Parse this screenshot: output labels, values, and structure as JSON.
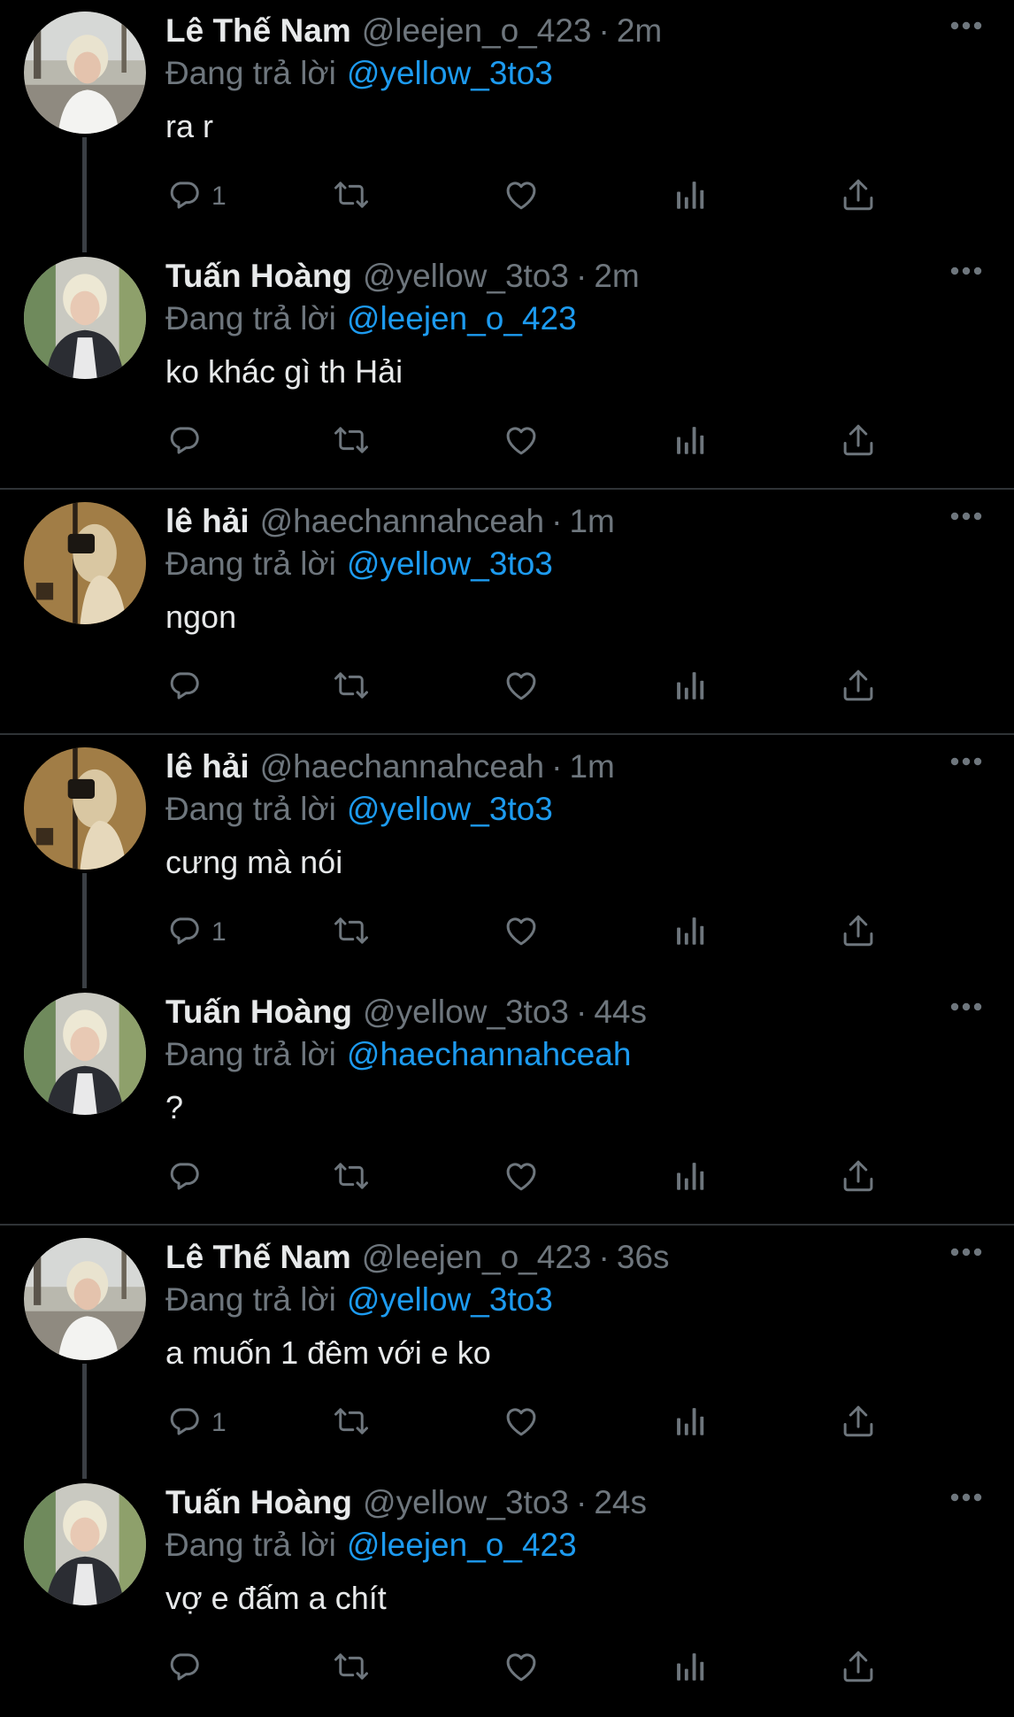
{
  "labels": {
    "replying_to": "Đang trả lời",
    "separator": "·"
  },
  "colors": {
    "background": "#000000",
    "text": "#e7e9ea",
    "muted": "#6e767d",
    "accent": "#1d9bf0",
    "divider": "#2f3336"
  },
  "icons": {
    "reply": "reply-icon",
    "retweet": "retweet-icon",
    "like": "heart-icon",
    "stats": "analytics-icon",
    "share": "share-icon",
    "more": "more-icon"
  },
  "tweets": [
    {
      "name": "Lê Thế Nam",
      "handle": "@leejen_o_423",
      "time": "2m",
      "reply_to": "@yellow_3to3",
      "text": "ra r",
      "reply_count": "1",
      "avatar": "blond-white-shirt",
      "thread_line": true
    },
    {
      "name": "Tuấn Hoàng",
      "handle": "@yellow_3to3",
      "time": "2m",
      "reply_to": "@leejen_o_423",
      "text": "ko khác gì th Hải",
      "reply_count": "",
      "avatar": "blond-tweed-jacket",
      "thread_line": false
    },
    {
      "name": "lê hải",
      "handle": "@haechannahceah",
      "time": "1m",
      "reply_to": "@yellow_3to3",
      "text": "ngon",
      "reply_count": "",
      "avatar": "camera-mirror",
      "thread_line": false
    },
    {
      "name": "lê hải",
      "handle": "@haechannahceah",
      "time": "1m",
      "reply_to": "@yellow_3to3",
      "text": "cưng mà nói",
      "reply_count": "1",
      "avatar": "camera-mirror",
      "thread_line": true
    },
    {
      "name": "Tuấn Hoàng",
      "handle": "@yellow_3to3",
      "time": "44s",
      "reply_to": "@haechannahceah",
      "text": "?",
      "reply_count": "",
      "avatar": "blond-tweed-jacket",
      "thread_line": false
    },
    {
      "name": "Lê Thế Nam",
      "handle": "@leejen_o_423",
      "time": "36s",
      "reply_to": "@yellow_3to3",
      "text": "a muốn 1 đêm với e ko",
      "reply_count": "1",
      "avatar": "blond-white-shirt",
      "thread_line": true
    },
    {
      "name": "Tuấn Hoàng",
      "handle": "@yellow_3to3",
      "time": "24s",
      "reply_to": "@leejen_o_423",
      "text": "vợ e đấm a chít",
      "reply_count": "",
      "avatar": "blond-tweed-jacket",
      "thread_line": false
    }
  ]
}
